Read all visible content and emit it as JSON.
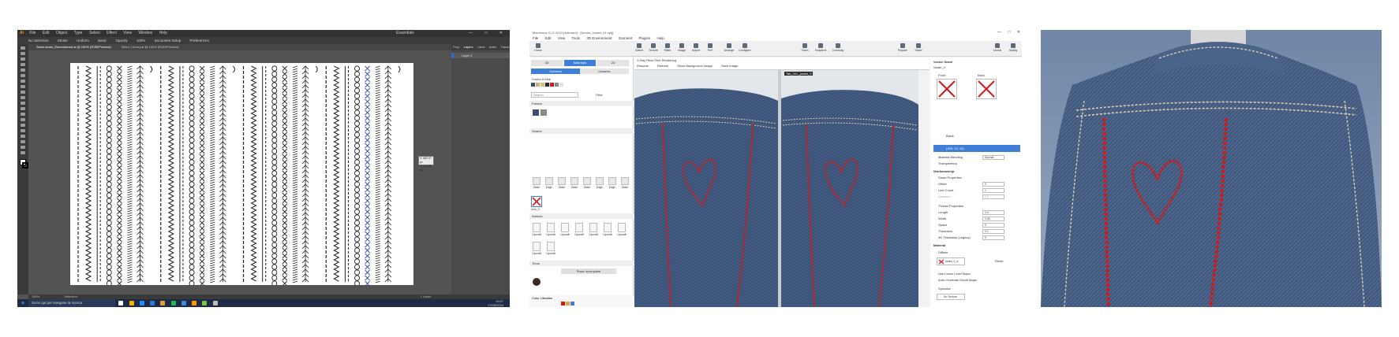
{
  "illustrator": {
    "menu": [
      "File",
      "Edit",
      "Object",
      "Type",
      "Select",
      "Effect",
      "View",
      "Window",
      "Help"
    ],
    "workspace": "Essentials",
    "window_controls": [
      "—",
      "□",
      "✕"
    ],
    "control_bar": [
      "No Selection",
      "Stroke",
      "Uniform",
      "Basic",
      "Opacity",
      "100%",
      "Document Setup",
      "Preferences"
    ],
    "doc_tabs": [
      "Sewn-seam_Embroidered.ai @ 150% (RGB/Preview)",
      "Stitch_Library.ai @ 100% (RGB/Preview)"
    ],
    "right_tabs": [
      "Prop",
      "Layers",
      "Librar",
      "Artbo",
      "Transf"
    ],
    "layer_name": "Layer 1",
    "tooltip": [
      "X: 682.97 px",
      "Y: 141.08 px"
    ],
    "status": [
      "150%",
      "Selection",
      "1 Layer"
    ],
    "taskbar_search": "Scrivi qui per eseguire la ricerca",
    "taskbar_clock": [
      "19:07",
      "17/05/2024"
    ]
  },
  "clo": {
    "title": "Marvelous CLO 2024 (Artboard) · [Denim_Jacket_01.zprj]",
    "window_controls": [
      "—",
      "□",
      "✕"
    ],
    "menu": [
      "File",
      "Edit",
      "View",
      "Tools",
      "3D Environment",
      "Garment",
      "Plugins",
      "Help"
    ],
    "toolbar": [
      "Select",
      "Texture",
      "Stitch",
      "Image",
      "Import",
      "Pen",
      "Arrange",
      "Configure",
      "Seam",
      "Snapshot",
      "Colorway",
      "Prepare",
      "Share",
      "Unreal",
      "Styling"
    ],
    "home": "Home",
    "lib_tabs": [
      "3D",
      "Materials",
      "2D"
    ],
    "sub_tabs": [
      "Garment",
      "Libraries"
    ],
    "colors_label": "Colors in Use",
    "search_placeholder": "Search",
    "filter": "Filter",
    "sections": [
      "Fabrics",
      "Seams",
      "Artwork",
      "Trims",
      "Color Libraries"
    ],
    "seam_names": [
      "Stitch",
      "Edge",
      "Stitch",
      "Stitch",
      "Stitch",
      "Edge",
      "Edge",
      "Stitch"
    ],
    "selected_seam": "zero_0",
    "piece_btn": "Place incomplete",
    "edge_btn": "Edge Incomplete",
    "art_labels": [
      "Upcraft",
      "Upcraft",
      "Upcraft",
      "Upcraft",
      "Upcraft",
      "Upcraft",
      "Upcraft",
      "Upcraft",
      "Upcraft"
    ],
    "render_title": "X-Ray Real-Time Rendering",
    "render_opts": [
      "Resume",
      "Refresh",
      "Show Background Image",
      "Save Image"
    ],
    "view_tabs": [
      "Tab_001_jacket_3"
    ],
    "right": {
      "title": "Vector Seam",
      "subtitle": "Seam_0",
      "front": "Front",
      "back": "Back",
      "type": "Black",
      "color": "(255, 10, 10)",
      "blending_label": "Material Blending",
      "blending_value": "Normal",
      "transparency": "Transparency",
      "workmanship": "Workmanship",
      "seam_props": "Seam Properties",
      "props": [
        [
          "Offset",
          "0"
        ],
        [
          "Line Count",
          "1"
        ],
        [
          "Distance",
          "0.0"
        ]
      ],
      "thread": "Thread Properties",
      "thread_props": [
        [
          "Length",
          "2.4"
        ],
        [
          "Width",
          "1.00"
        ],
        [
          "Space",
          "0"
        ],
        [
          "Thickness",
          "0.1"
        ],
        [
          "3D Thickness (Legacy)",
          "0"
        ]
      ],
      "material": "Material",
      "diffuse": "Diffuse",
      "texture": "seam_0_d",
      "reset": "Reset",
      "checks": [
        "Use Lower Level Maps",
        "Auto-Generate Depth Maps"
      ],
      "specular": "Specular",
      "notexture": "No Texture"
    }
  },
  "colors": {
    "accent": "#3f7fd8",
    "denim": "#3b5277",
    "stitch_red": "#d01a1a",
    "thread": "#d9cdb0"
  }
}
